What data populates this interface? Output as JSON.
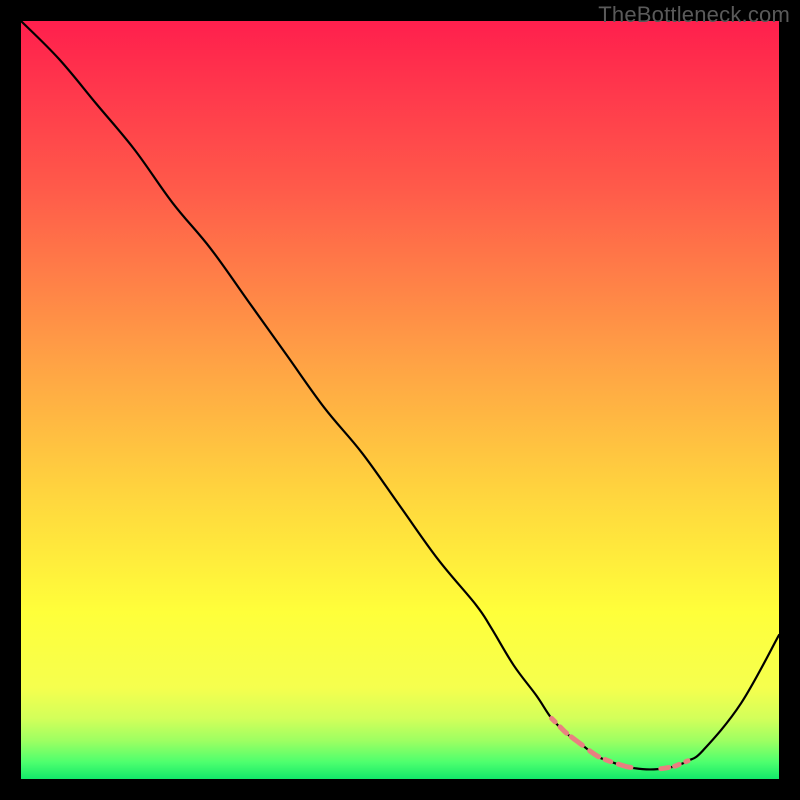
{
  "watermark": "TheBottleneck.com",
  "chart_data": {
    "type": "line",
    "title": "",
    "xlabel": "",
    "ylabel": "",
    "ylim": [
      0,
      100
    ],
    "xlim": [
      0,
      100
    ],
    "x": [
      0,
      5,
      10,
      15,
      20,
      25,
      30,
      35,
      40,
      45,
      50,
      55,
      60,
      62,
      65,
      68,
      70,
      72,
      74,
      76,
      78,
      80,
      82,
      84,
      86,
      88,
      90,
      95,
      100
    ],
    "values": [
      100,
      95,
      89,
      83,
      76,
      70,
      63,
      56,
      49,
      43,
      36,
      29,
      23,
      20,
      15,
      11,
      8,
      6,
      4.5,
      3,
      2.2,
      1.6,
      1.3,
      1.3,
      1.6,
      2.4,
      3.8,
      10,
      19
    ],
    "marker_region_x": [
      70,
      88
    ],
    "marker_stroke_width": 5,
    "curve_color": "#000000",
    "marker_color": "#e98080",
    "gradient": [
      {
        "stop": 0.0,
        "color": "#ff1f4d"
      },
      {
        "stop": 0.22,
        "color": "#ff5a4a"
      },
      {
        "stop": 0.45,
        "color": "#ffa245"
      },
      {
        "stop": 0.62,
        "color": "#ffd43e"
      },
      {
        "stop": 0.78,
        "color": "#ffff3a"
      },
      {
        "stop": 0.88,
        "color": "#f5ff4e"
      },
      {
        "stop": 0.92,
        "color": "#d3ff5a"
      },
      {
        "stop": 0.95,
        "color": "#9cff62"
      },
      {
        "stop": 0.978,
        "color": "#4dff6e"
      },
      {
        "stop": 1.0,
        "color": "#12e86a"
      }
    ]
  }
}
